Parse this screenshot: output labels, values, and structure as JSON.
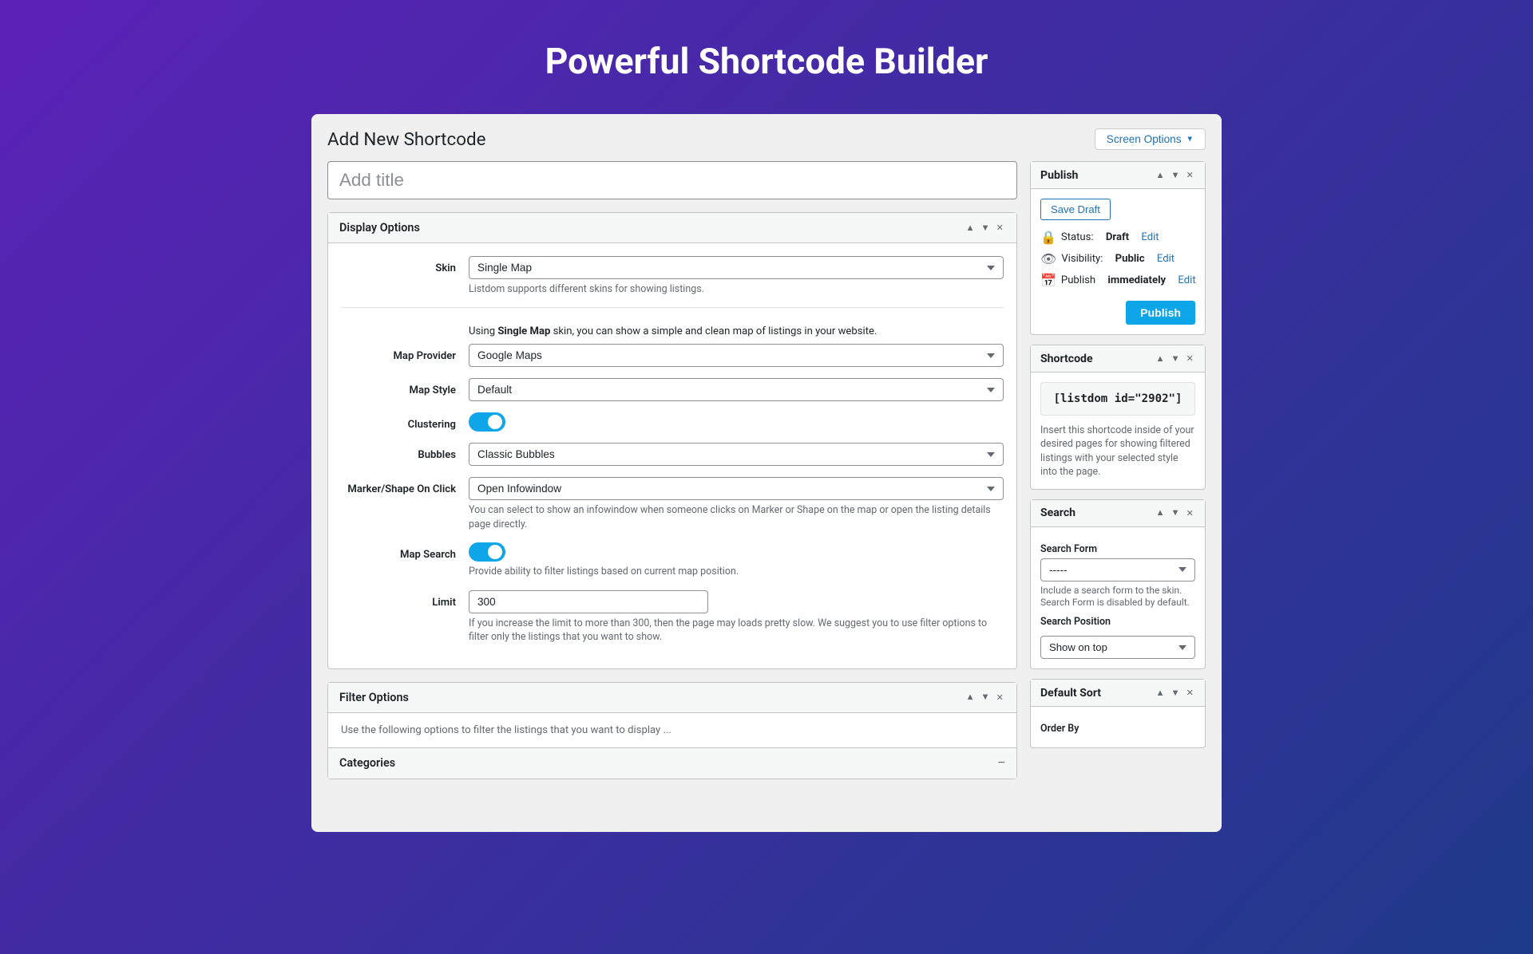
{
  "hero": {
    "title": "Powerful Shortcode Builder"
  },
  "page": {
    "title": "Add New Shortcode",
    "screen_options_label": "Screen Options"
  },
  "title_input": {
    "placeholder": "Add title",
    "value": ""
  },
  "display_options": {
    "section_title": "Display Options",
    "skin_label": "Skin",
    "skin_options": [
      "Single Map"
    ],
    "skin_selected": "Single Map",
    "skin_hint": "Listdom supports different skins for showing listings.",
    "info_text_1": "Using ",
    "info_skin": "Single Map",
    "info_text_2": " skin, you can show a simple and clean map of listings in your website.",
    "map_provider_label": "Map Provider",
    "map_provider_options": [
      "Google Maps"
    ],
    "map_provider_selected": "Google Maps",
    "map_style_label": "Map Style",
    "map_style_options": [
      "Default"
    ],
    "map_style_selected": "Default",
    "clustering_label": "Clustering",
    "clustering_enabled": true,
    "bubbles_label": "Bubbles",
    "bubbles_options": [
      "Classic Bubbles"
    ],
    "bubbles_selected": "Classic Bubbles",
    "marker_label": "Marker/Shape On Click",
    "marker_options": [
      "Open Infowindow"
    ],
    "marker_selected": "Open Infowindow",
    "marker_hint": "You can select to show an infowindow when someone clicks on Marker or Shape on the map or open the listing details page directly.",
    "map_search_label": "Map Search",
    "map_search_enabled": true,
    "map_search_hint": "Provide ability to filter listings based on current map position.",
    "limit_label": "Limit",
    "limit_value": "300",
    "limit_hint": "If you increase the limit to more than 300, then the page may loads pretty slow. We suggest you to use filter options to filter only the listings that you want to show."
  },
  "filter_options": {
    "section_title": "Filter Options",
    "hint": "Use the following options to filter the listings that you want to display ..."
  },
  "categories": {
    "section_title": "Categories"
  },
  "publish_panel": {
    "title": "Publish",
    "save_draft_label": "Save Draft",
    "status_label": "Status:",
    "status_value": "Draft",
    "status_edit": "Edit",
    "visibility_label": "Visibility:",
    "visibility_value": "Public",
    "visibility_edit": "Edit",
    "publish_time_label": "Publish",
    "publish_time_value": "immediately",
    "publish_time_edit": "Edit",
    "publish_btn_label": "Publish"
  },
  "shortcode_panel": {
    "title": "Shortcode",
    "code": "[listdom id=\"2902\"]",
    "description": "Insert this shortcode inside of your desired pages for showing filtered listings with your selected style into the page."
  },
  "search_panel": {
    "title": "Search",
    "search_form_label": "Search Form",
    "search_form_options": [
      "-----"
    ],
    "search_form_selected": "-----",
    "search_form_hint": "Include a search form to the skin. Search Form is disabled by default.",
    "search_position_label": "Search Position",
    "search_position_options": [
      "Show on top"
    ],
    "search_position_selected": "Show on top"
  },
  "default_sort_panel": {
    "title": "Default Sort",
    "order_by_label": "Order By"
  }
}
